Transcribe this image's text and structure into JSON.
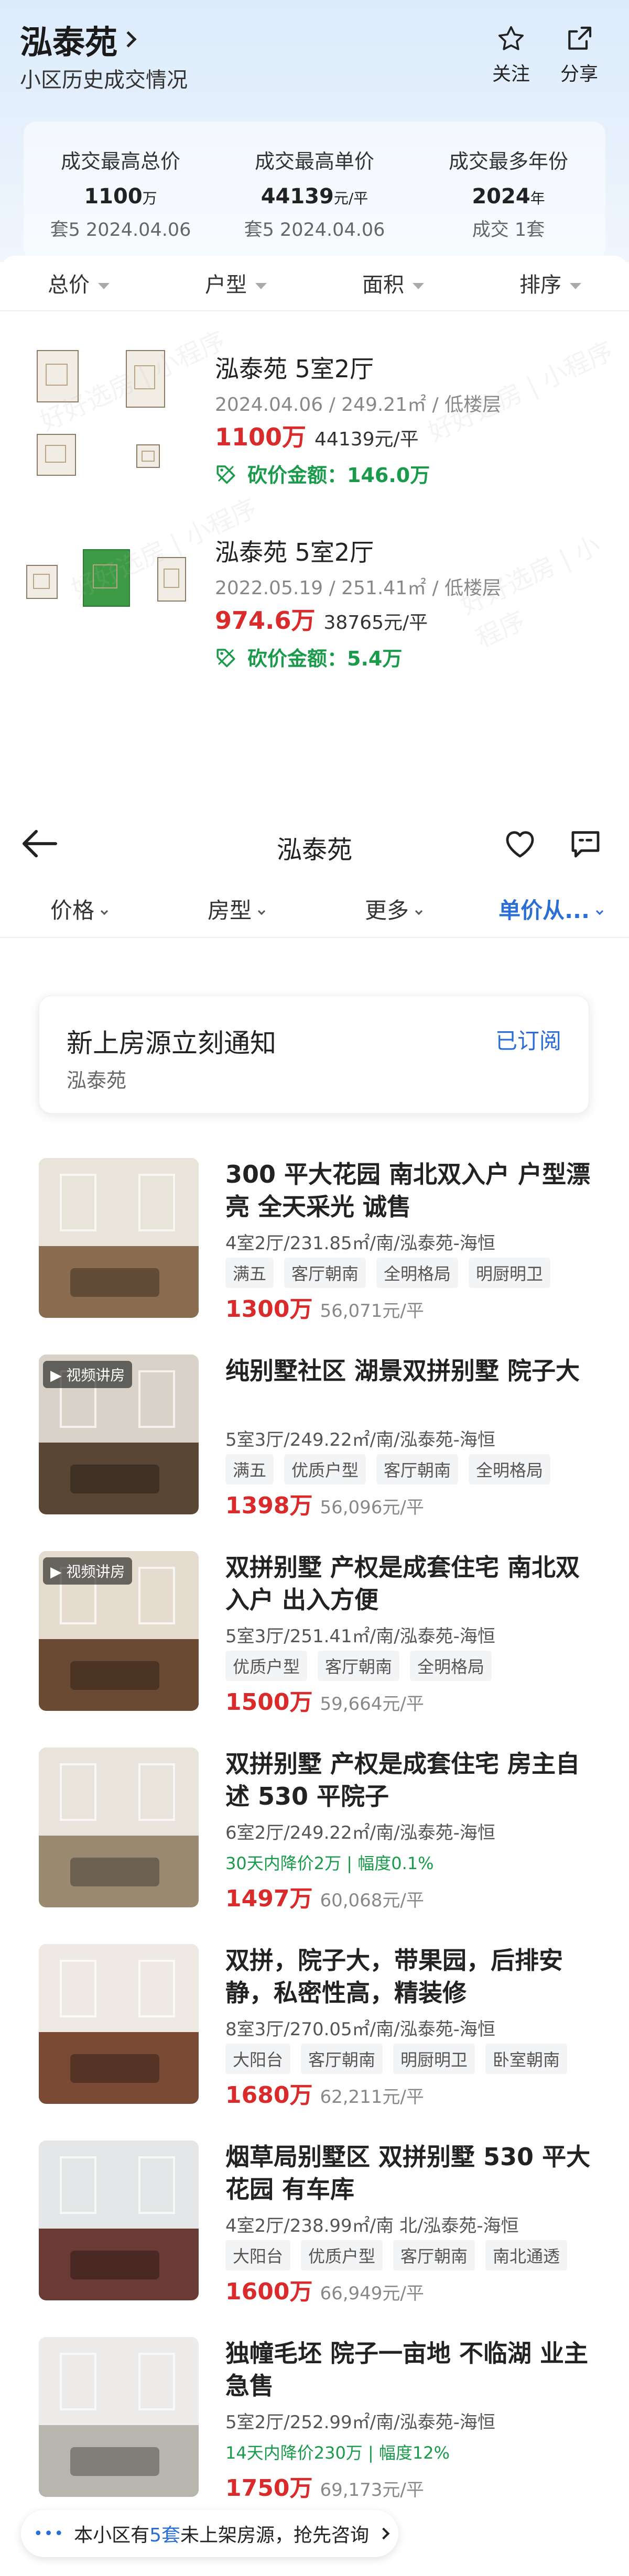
{
  "header": {
    "community": "泓泰苑",
    "subtitle": "小区历史成交情况",
    "follow_label": "关注",
    "share_label": "分享"
  },
  "stats": [
    {
      "label": "成交最高总价",
      "value": "1100",
      "unit": "万",
      "sub": "套5 2024.04.06"
    },
    {
      "label": "成交最高单价",
      "value": "44139",
      "unit": "元/平",
      "sub": "套5 2024.04.06"
    },
    {
      "label": "成交最多年份",
      "value": "2024",
      "unit": "年",
      "sub": "成交 1套"
    }
  ],
  "filters": [
    "总价",
    "户型",
    "面积",
    "排序"
  ],
  "deals": [
    {
      "title": "泓泰苑 5室2厅",
      "meta": "2024.04.06 / 249.21㎡ / 低楼层",
      "price": "1100万",
      "unit_price": "44139元/平",
      "cut": "砍价金额：146.0万"
    },
    {
      "title": "泓泰苑 5室2厅",
      "meta": "2022.05.19 / 251.41㎡ / 低楼层",
      "price": "974.6万",
      "unit_price": "38765元/平",
      "cut": "砍价金额：5.4万"
    }
  ],
  "watermark": "好好选房 | 小程序",
  "listing_nav": {
    "title": "泓泰苑",
    "tabs": [
      "价格",
      "房型",
      "更多",
      "单价从..."
    ]
  },
  "notify": {
    "title": "新上房源立刻通知",
    "subtitle": "泓泰苑",
    "button": "已订阅"
  },
  "video_badge": "▶ 视频讲房",
  "listings": [
    {
      "title": "300 平大花园 南北双入户 户型漂亮 全天采光 诚售",
      "meta": "4室2厅/231.85㎡/南/泓泰苑-海恒",
      "tags": [
        "满五",
        "客厅朝南",
        "全明格局",
        "明厨明卫"
      ],
      "drop": "",
      "price": "1300万",
      "unit": "56,071元/平",
      "video": false
    },
    {
      "title": "纯别墅社区 湖景双拼别墅 院子大",
      "meta": "5室3厅/249.22㎡/南/泓泰苑-海恒",
      "tags": [
        "满五",
        "优质户型",
        "客厅朝南",
        "全明格局"
      ],
      "drop": "",
      "price": "1398万",
      "unit": "56,096元/平",
      "video": true
    },
    {
      "title": "双拼别墅 产权是成套住宅 南北双入户 出入方便",
      "meta": "5室3厅/251.41㎡/南/泓泰苑-海恒",
      "tags": [
        "优质户型",
        "客厅朝南",
        "全明格局"
      ],
      "drop": "",
      "price": "1500万",
      "unit": "59,664元/平",
      "video": true
    },
    {
      "title": "双拼别墅 产权是成套住宅 房主自述 530 平院子",
      "meta": "6室2厅/249.22㎡/南/泓泰苑-海恒",
      "tags": [],
      "drop": "30天内降价2万 | 幅度0.1%",
      "price": "1497万",
      "unit": "60,068元/平",
      "video": false
    },
    {
      "title": "双拼，院子大，带果园，后排安静，私密性高，精装修",
      "meta": "8室3厅/270.05㎡/南/泓泰苑-海恒",
      "tags": [
        "大阳台",
        "客厅朝南",
        "明厨明卫",
        "卧室朝南"
      ],
      "drop": "",
      "price": "1680万",
      "unit": "62,211元/平",
      "video": false
    },
    {
      "title": "烟草局别墅区  双拼别墅  530 平大花园  有车库",
      "meta": "4室2厅/238.99㎡/南 北/泓泰苑-海恒",
      "tags": [
        "大阳台",
        "优质户型",
        "客厅朝南",
        "南北通透"
      ],
      "drop": "",
      "price": "1600万",
      "unit": "66,949元/平",
      "video": false
    },
    {
      "title": "独幢毛坯 院子一亩地 不临湖 业主急售",
      "meta": "5室2厅/252.99㎡/南/泓泰苑-海恒",
      "tags": [],
      "drop": "14天内降价230万 | 幅度12%",
      "price": "1750万",
      "unit": "69,173元/平",
      "video": false
    }
  ],
  "footer": {
    "dots": "•••",
    "pre": "本小区有",
    "count": "5套",
    "post": "未上架房源，抢先咨询"
  },
  "colors": {
    "accent": "#2b6fd6",
    "price": "#d92b2b",
    "green": "#1a9a4b"
  }
}
